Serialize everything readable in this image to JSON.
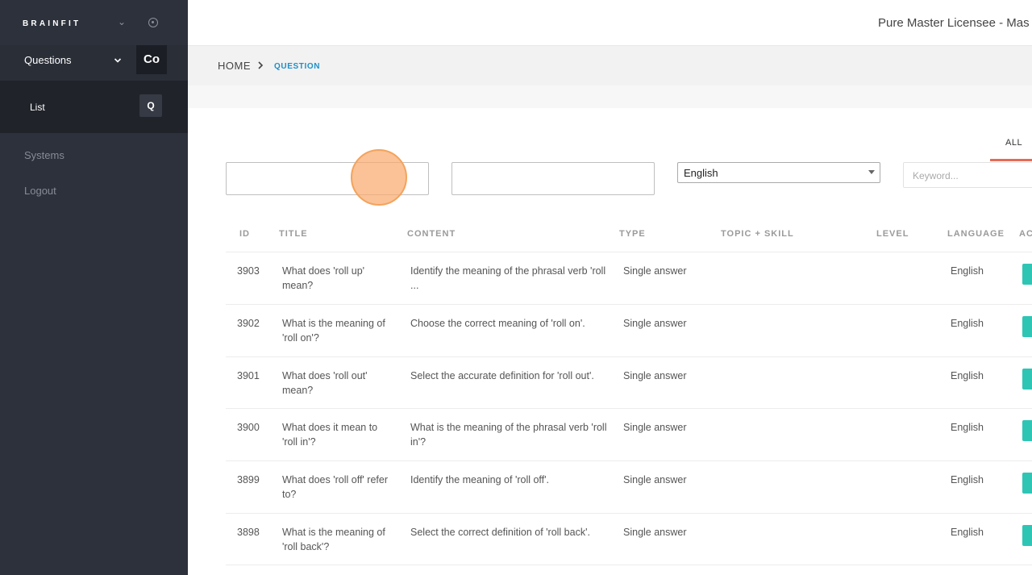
{
  "sidebar": {
    "brand": "BRAINFIT",
    "group_label": "Questions",
    "group_badge": "Co",
    "submenu_label": "List",
    "submenu_badge": "Q",
    "links": [
      "Systems",
      "Logout"
    ]
  },
  "header": {
    "licensee": "Pure Master Licensee - Mas"
  },
  "breadcrumb": {
    "home": "HOME",
    "separator": ">",
    "current": "QUESTION"
  },
  "filters": {
    "tab_all": "ALL",
    "language_selected": "English",
    "keyword_placeholder": "Keyword..."
  },
  "table": {
    "columns": [
      "ID",
      "TITLE",
      "CONTENT",
      "TYPE",
      "TOPIC + SKILL",
      "LEVEL",
      "LANGUAGE",
      "AC"
    ],
    "rows": [
      {
        "id": "3903",
        "title": "What does 'roll up' mean?",
        "content": "Identify the meaning of the phrasal verb 'roll ...",
        "type": "Single answer",
        "language": "English"
      },
      {
        "id": "3902",
        "title": "What is the meaning of 'roll on'?",
        "content": "Choose the correct meaning of 'roll on'.",
        "type": "Single answer",
        "language": "English"
      },
      {
        "id": "3901",
        "title": "What does 'roll out' mean?",
        "content": "Select the accurate definition for 'roll out'.",
        "type": "Single answer",
        "language": "English"
      },
      {
        "id": "3900",
        "title": "What does it mean to 'roll in'?",
        "content": "What is the meaning of the phrasal verb 'roll in'?",
        "type": "Single answer",
        "language": "English"
      },
      {
        "id": "3899",
        "title": "What does 'roll off' refer to?",
        "content": "Identify the meaning of 'roll off'.",
        "type": "Single answer",
        "language": "English"
      },
      {
        "id": "3898",
        "title": "What is the meaning of 'roll back'?",
        "content": "Select the correct definition of 'roll back'.",
        "type": "Single answer",
        "language": "English"
      }
    ]
  },
  "colors": {
    "sidebar_bg": "#2d313b",
    "accent_blue": "#1d8fc9",
    "tab_underline": "#e46b57",
    "action_green": "#2ec5b5",
    "cursor_orange": "#f3a35c"
  }
}
